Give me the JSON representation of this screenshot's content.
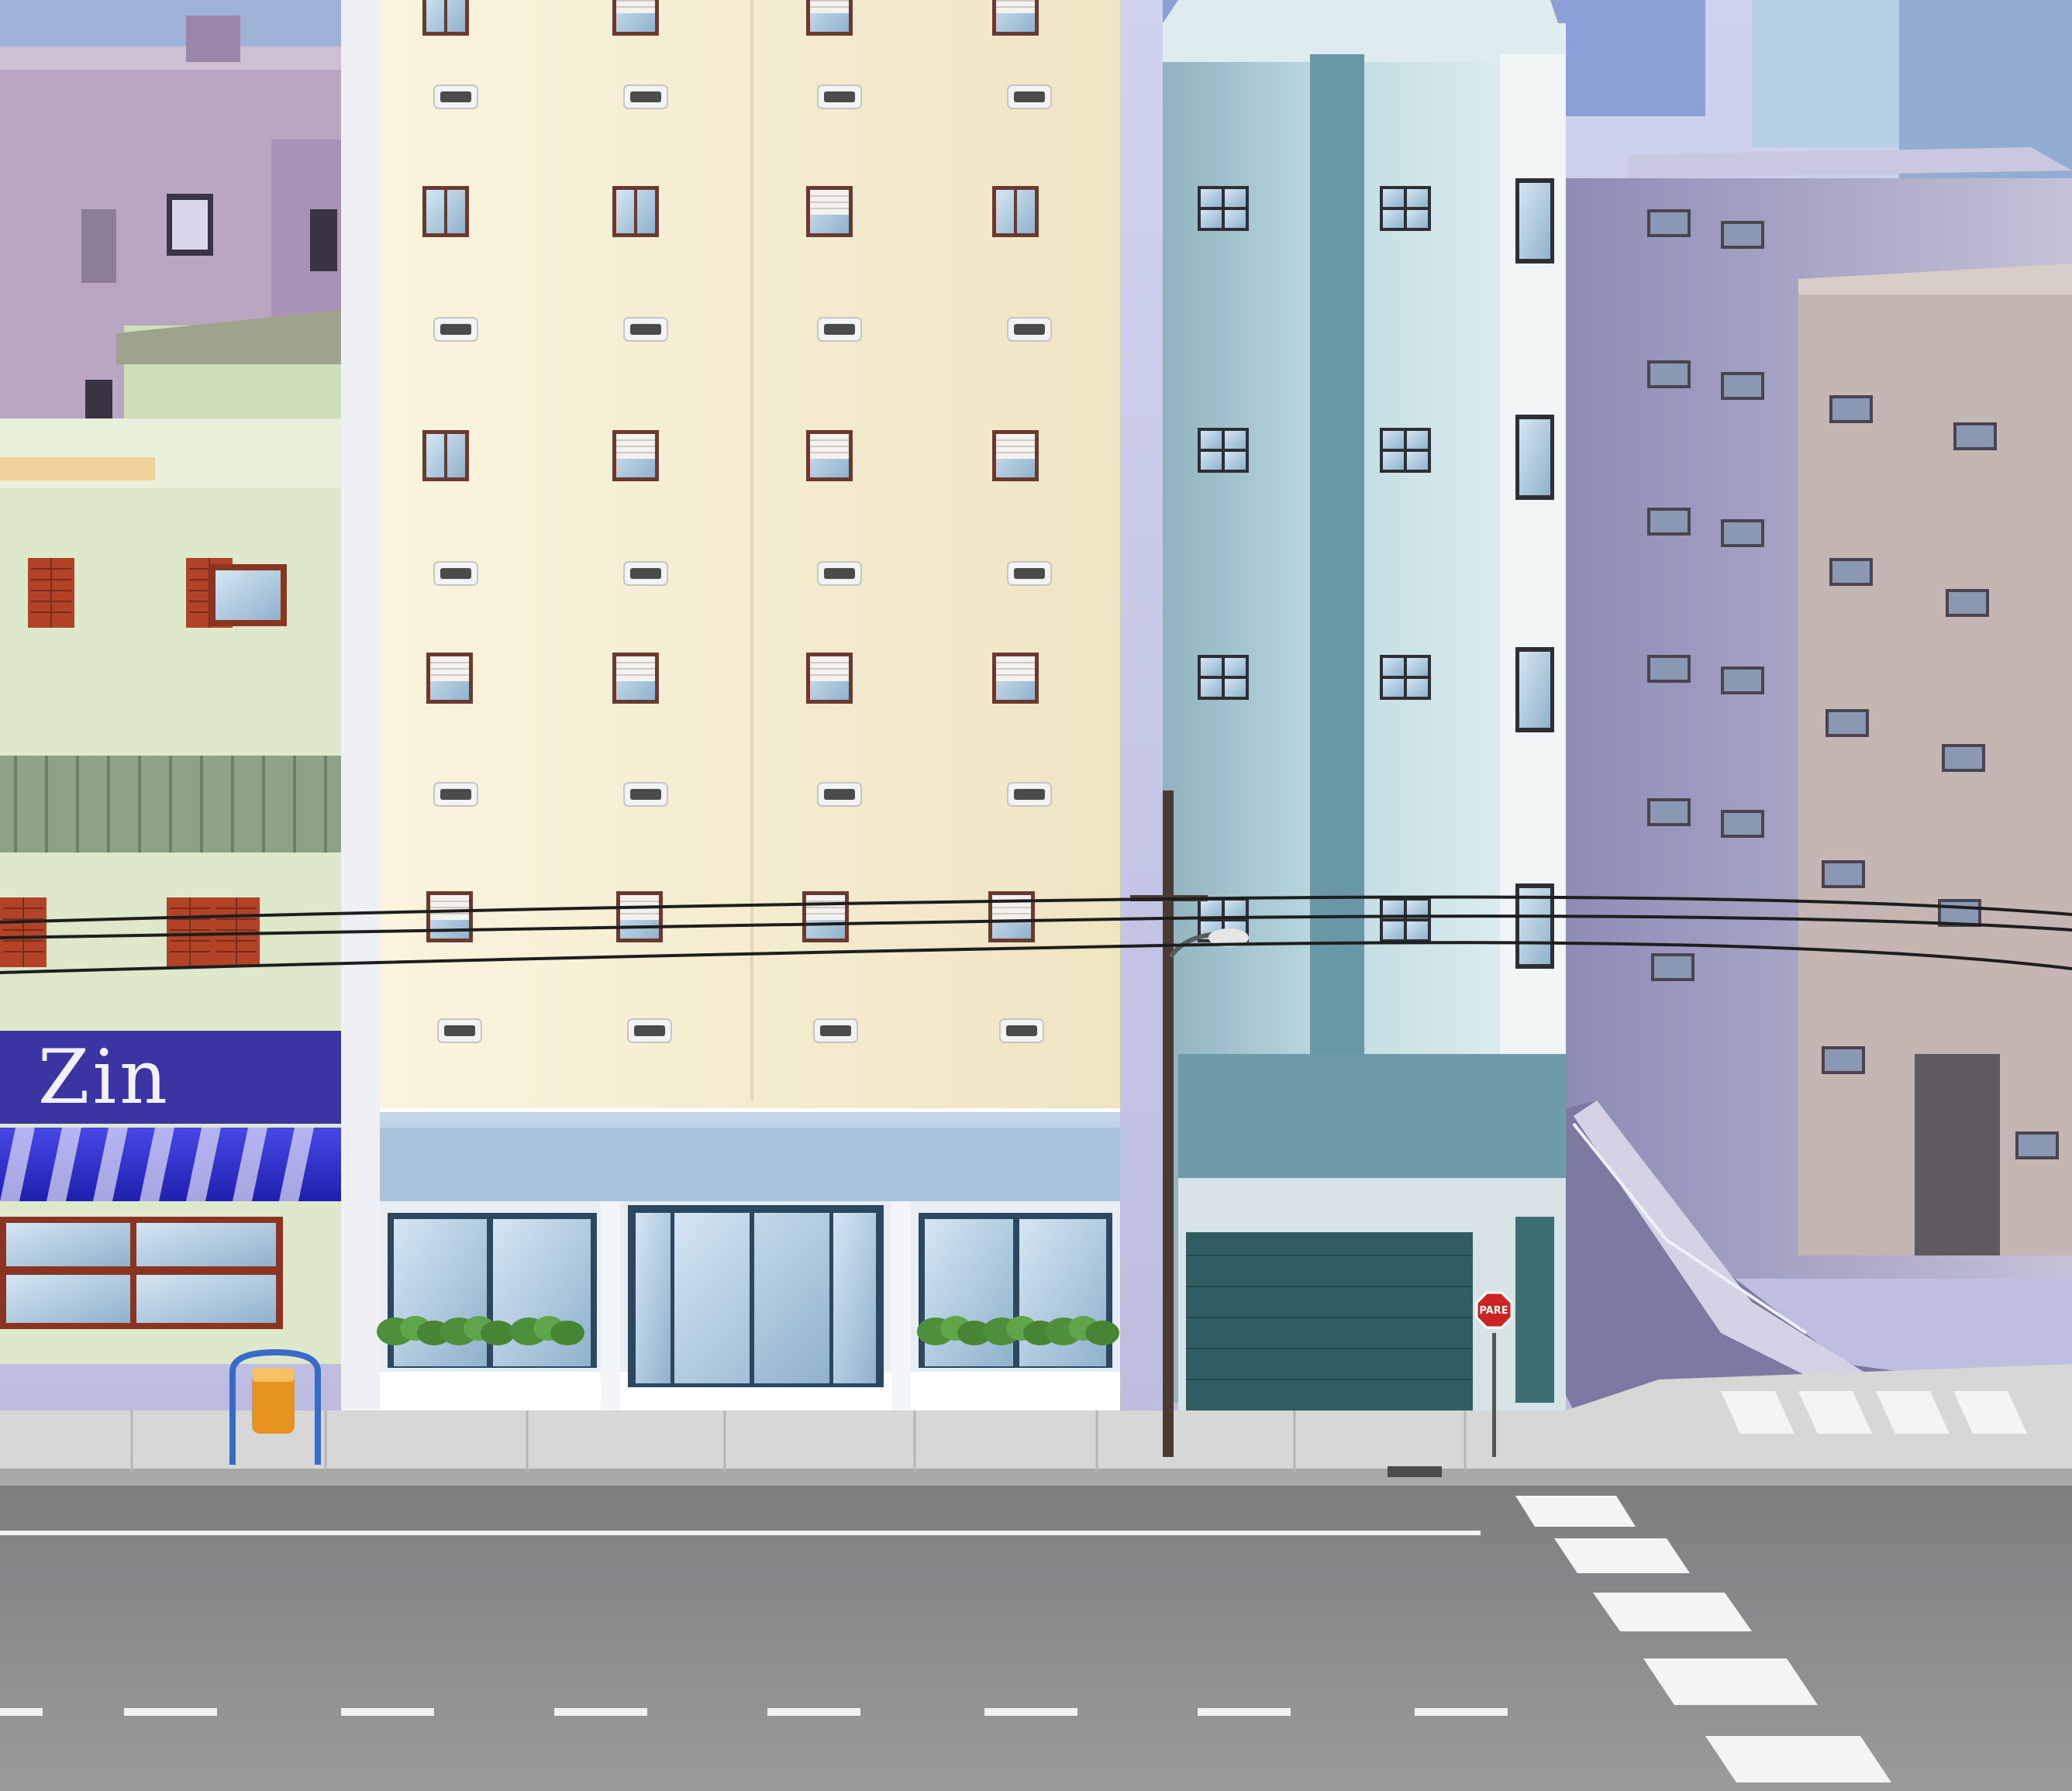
{
  "scene": {
    "shop_sign": "Zin",
    "stop_sign": "PARE"
  },
  "colors": {
    "sky": "#c7c6e6",
    "cream_tower": "#f6efd6",
    "teal_tower": "#a9c8d1",
    "green_house": "#dbe8c8",
    "road": "#8e8e8e",
    "sidewalk": "#cfcfcf",
    "awning_blue": "#2a2ad0"
  }
}
